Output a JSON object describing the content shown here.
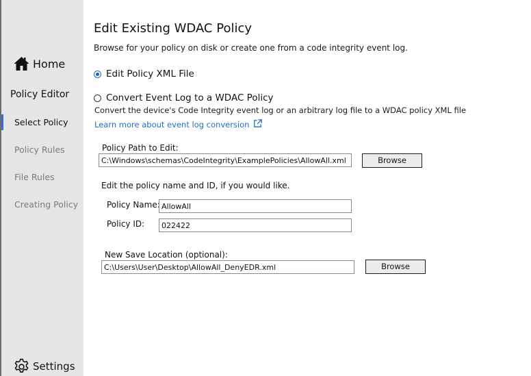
{
  "sidebar": {
    "home_label": "Home",
    "section_title": "Policy Editor",
    "items": [
      {
        "label": "Select Policy"
      },
      {
        "label": "Policy Rules"
      },
      {
        "label": "File Rules"
      },
      {
        "label": "Creating Policy"
      }
    ],
    "active_item": "Select Policy",
    "settings_label": "Settings"
  },
  "main": {
    "title": "Edit Existing WDAC Policy",
    "subtitle": "Browse for your policy on disk or create one from a code integrity event log.",
    "options": [
      {
        "label": "Edit Policy XML File",
        "selected": true
      },
      {
        "label": "Convert Event Log to a WDAC Policy",
        "selected": false
      }
    ],
    "convert_description": "Convert the device's Code Integrity event log or an arbitrary log file to a WDAC policy XML file",
    "learn_more_link": "Learn more about event log conversion",
    "policy_path": {
      "label": "Policy Path to Edit:",
      "value": "C:\\Windows\\schemas\\CodeIntegrity\\ExamplePolicies\\AllowAll.xml",
      "browse_label": "Browse"
    },
    "edit_prompt": "Edit the policy name and ID, if you would like.",
    "policy_name": {
      "label": "Policy Name:",
      "value": "AllowAll"
    },
    "policy_id": {
      "label": "Policy ID:",
      "value": "022422"
    },
    "save_location": {
      "label": "New Save Location (optional):",
      "value": "C:\\Users\\User\\Desktop\\AllowAll_DenyEDR.xml",
      "browse_label": "Browse"
    }
  },
  "colors": {
    "sidebar_bg": "#e6e6e6",
    "accent": "#1668c8",
    "link": "#1f6fc9",
    "inactive_text": "#7a7a7a"
  },
  "icons": {
    "home": "home-icon",
    "settings": "gear-icon",
    "external_link": "external-link-icon"
  }
}
